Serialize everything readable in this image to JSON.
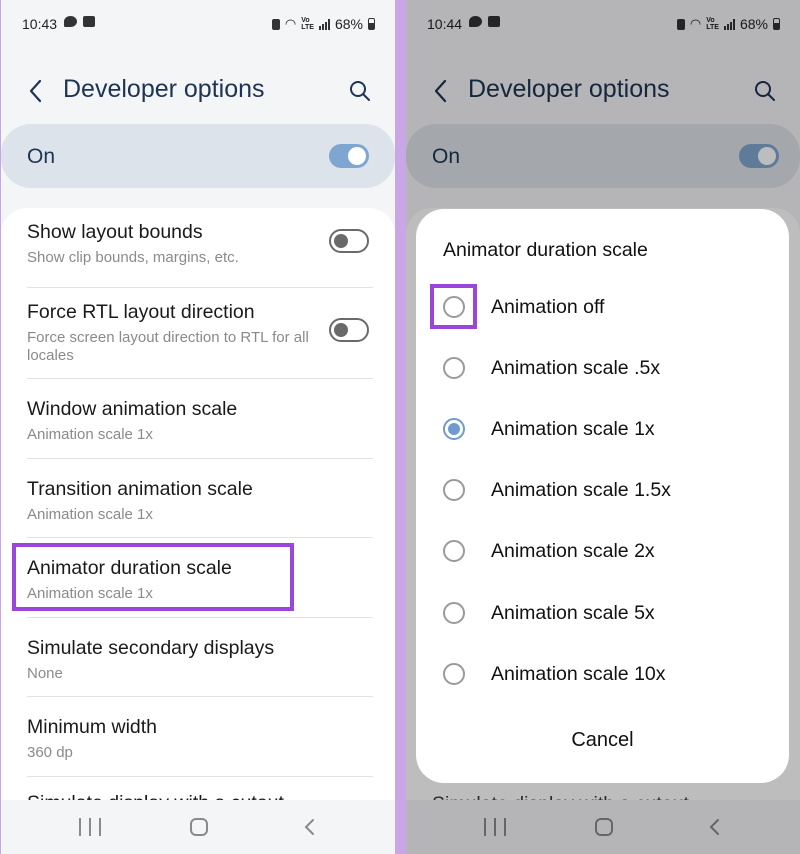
{
  "left": {
    "status": {
      "time": "10:43",
      "battery": "68%"
    },
    "appbar": {
      "title": "Developer options"
    },
    "master": {
      "label": "On",
      "state": "on"
    },
    "items": [
      {
        "title": "Show layout bounds",
        "subtitle": "Show clip bounds, margins, etc.",
        "toggle": "off"
      },
      {
        "title": "Force RTL layout direction",
        "subtitle": "Force screen layout direction to RTL for all locales",
        "toggle": "off"
      },
      {
        "title": "Window animation scale",
        "subtitle": "Animation scale 1x"
      },
      {
        "title": "Transition animation scale",
        "subtitle": "Animation scale 1x"
      },
      {
        "title": "Animator duration scale",
        "subtitle": "Animation scale 1x",
        "highlighted": true
      },
      {
        "title": "Simulate secondary displays",
        "subtitle": "None"
      },
      {
        "title": "Minimum width",
        "subtitle": "360 dp"
      },
      {
        "title": "Simulate display with a cutout",
        "subtitle": ""
      }
    ]
  },
  "right": {
    "status": {
      "time": "10:44",
      "battery": "68%"
    },
    "appbar": {
      "title": "Developer options"
    },
    "master": {
      "label": "On",
      "state": "on"
    },
    "dialog": {
      "title": "Animator duration scale",
      "options": [
        {
          "label": "Animation off",
          "selected": false,
          "highlighted": true
        },
        {
          "label": "Animation scale .5x",
          "selected": false
        },
        {
          "label": "Animation scale 1x",
          "selected": true
        },
        {
          "label": "Animation scale 1.5x",
          "selected": false
        },
        {
          "label": "Animation scale 2x",
          "selected": false
        },
        {
          "label": "Animation scale 5x",
          "selected": false
        },
        {
          "label": "Animation scale 10x",
          "selected": false
        }
      ],
      "cancel_label": "Cancel"
    },
    "peek_text": "Simulate display with a cutout"
  },
  "colors": {
    "accent": "#7fa6d0",
    "highlight": "#9b45d9",
    "title_text": "#1d3453"
  }
}
